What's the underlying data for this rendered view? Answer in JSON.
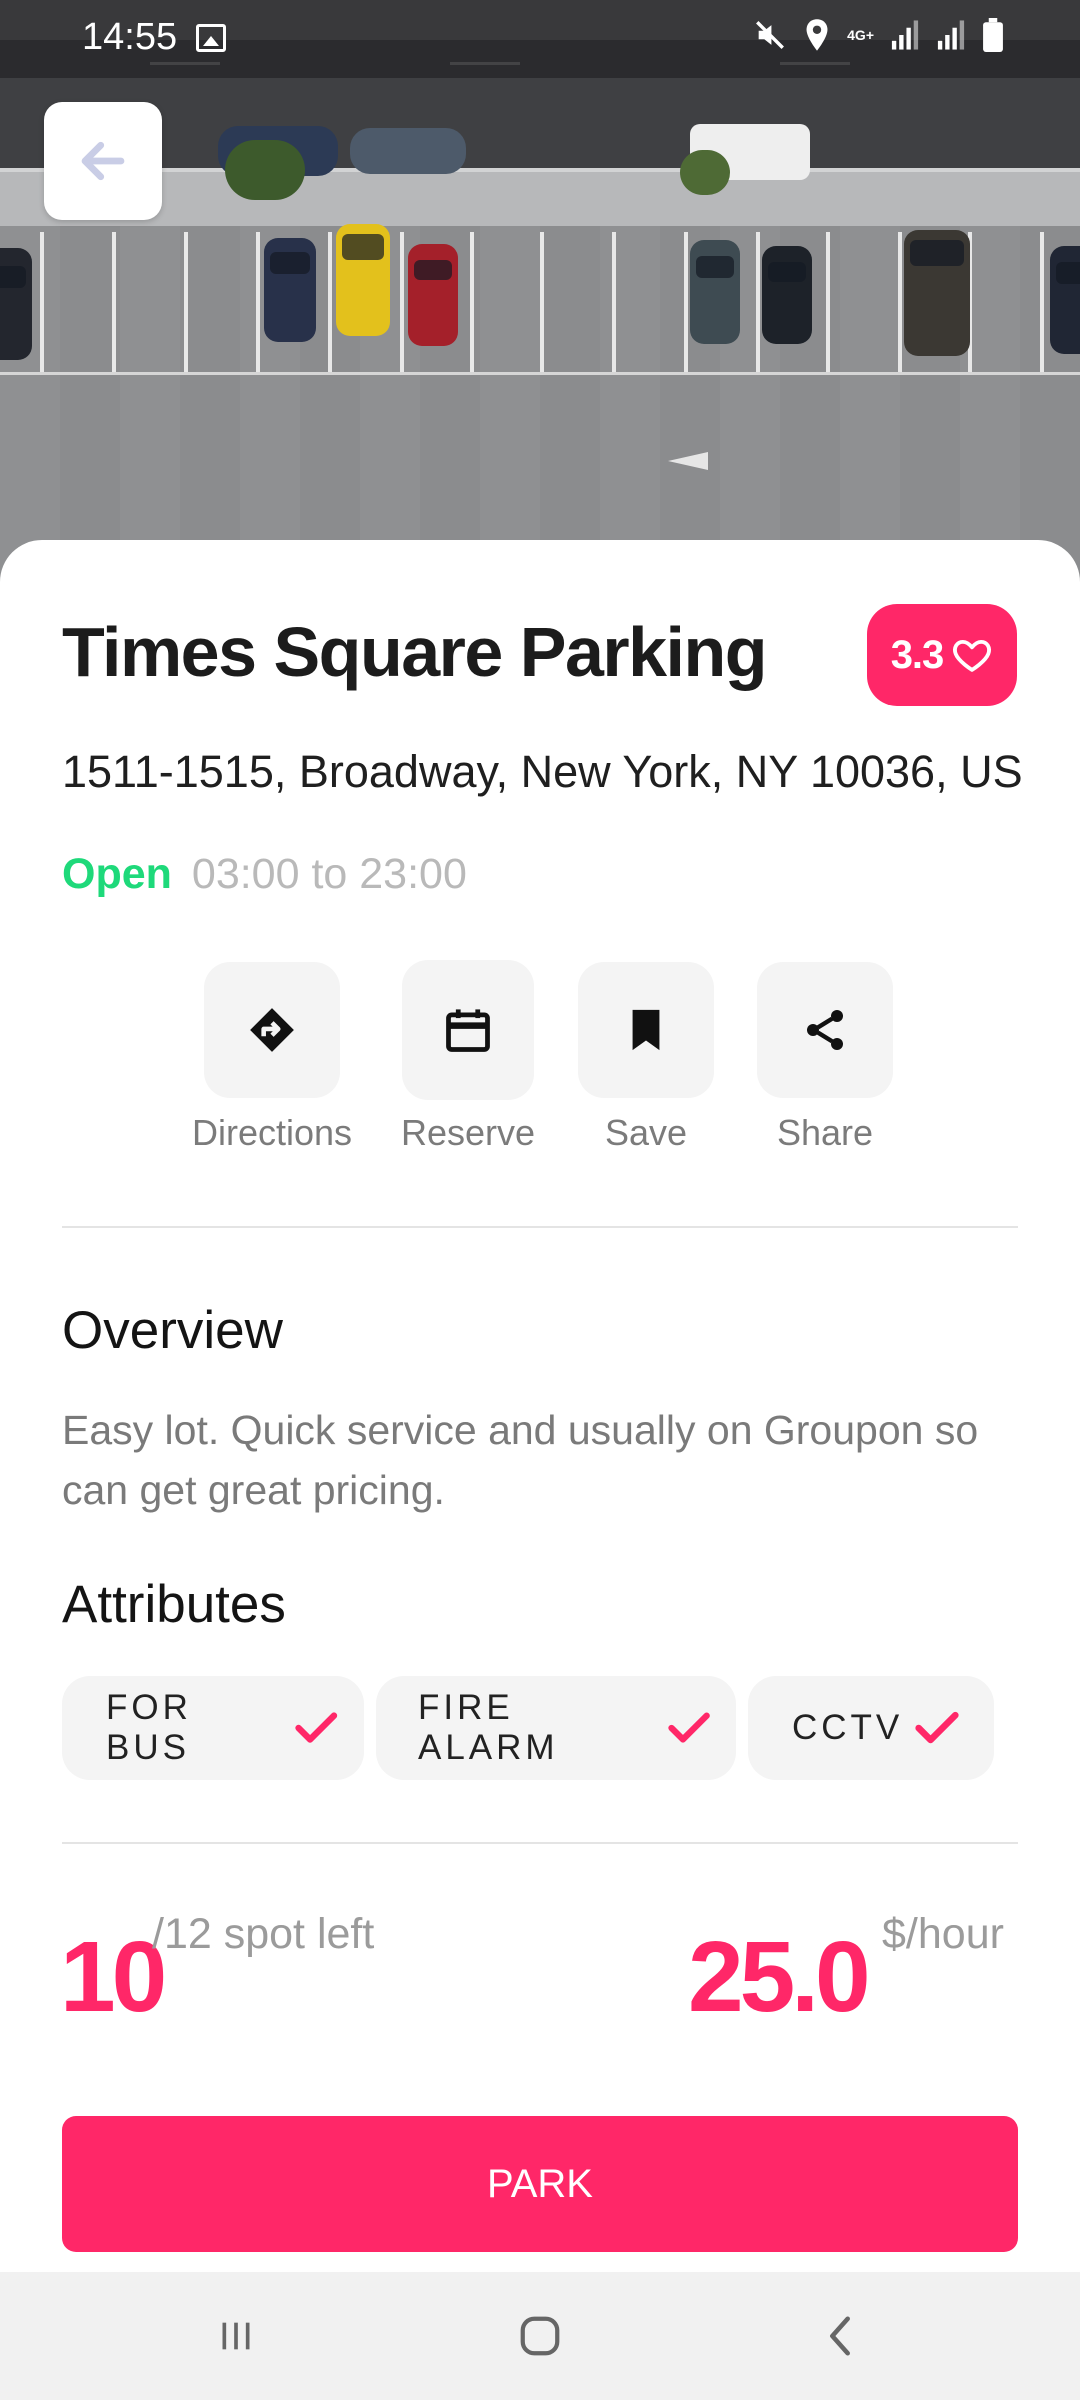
{
  "status_bar": {
    "time": "14:55",
    "network": "4G+",
    "icons": [
      "gallery-icon",
      "mute-icon",
      "location-icon",
      "signal-icon",
      "signal-icon",
      "battery-icon"
    ]
  },
  "hero": {
    "image": "parking-lot-aerial-photo"
  },
  "lot": {
    "name": "Times Square Parking",
    "rating": "3.3",
    "address": "1511-1515, Broadway, New York, NY 10036, US",
    "status": "Open",
    "hours": "03:00 to 23:00"
  },
  "actions": [
    {
      "label": "Directions",
      "icon": "directions-icon"
    },
    {
      "label": "Reserve",
      "icon": "calendar-icon"
    },
    {
      "label": "Save",
      "icon": "bookmark-icon"
    },
    {
      "label": "Share",
      "icon": "share-icon"
    }
  ],
  "overview": {
    "heading": "Overview",
    "text": "Easy lot. Quick service and usually on Groupon so can get great pricing."
  },
  "attributes": {
    "heading": "Attributes",
    "items": [
      "FOR BUS",
      "FIRE ALARM",
      "CCTV"
    ]
  },
  "availability": {
    "spots_left": "10",
    "spots_suffix": "/12 spot left",
    "price": "25.0",
    "price_unit": "$/hour"
  },
  "park_button": "PARK",
  "colors": {
    "accent": "#ff2768",
    "open": "#1ed97a",
    "muted": "#7a7a7a"
  },
  "navbar": {
    "items": [
      "recent-apps-icon",
      "home-icon",
      "back-icon"
    ]
  }
}
